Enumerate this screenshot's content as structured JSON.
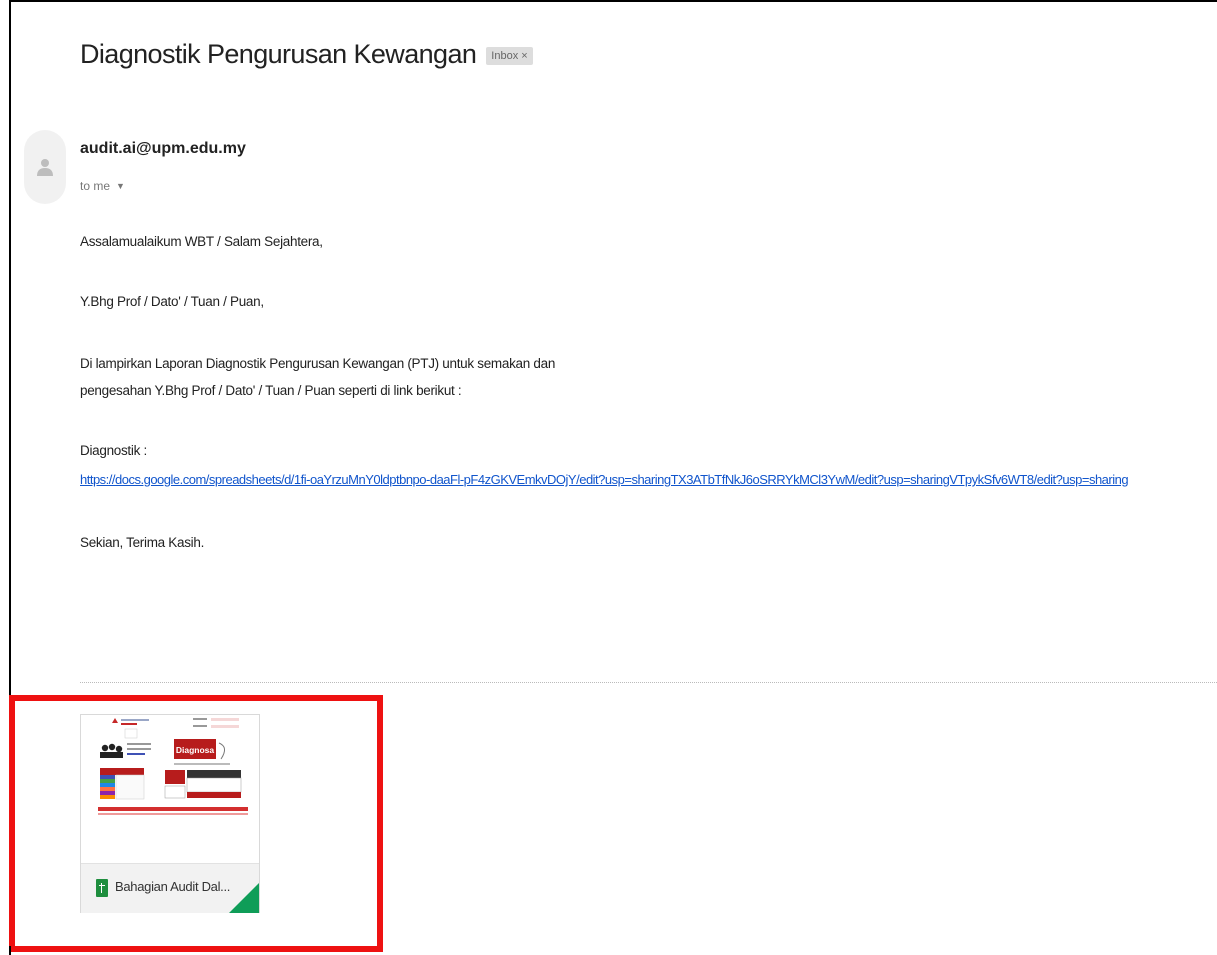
{
  "email": {
    "subject": "Diagnostik Pengurusan Kewangan",
    "label": "Inbox",
    "label_close": "×",
    "sender": "audit.ai@upm.edu.my",
    "recipient": "to me",
    "recipient_caret": "▼"
  },
  "body": {
    "greeting": "Assalamualaikum WBT / Salam Sejahtera,",
    "salutation": "Y.Bhg Prof / Dato' / Tuan / Puan,",
    "para1_line1": "Di lampirkan Laporan Diagnostik Pengurusan Kewangan (PTJ) untuk semakan dan",
    "para1_line2": "pengesahan Y.Bhg Prof / Dato' / Tuan / Puan seperti di link berikut :",
    "diagnostik_label": "Diagnostik :",
    "link": "https://docs.google.com/spreadsheets/d/1fi-oaYrzuMnY0ldptbnpo-daaFl-pF4zGKVEmkvDOjY/edit?usp=sharingTX3ATbTfNkJ6oSRRYkMCl3YwM/edit?usp=sharingVTpykSfv6WT8/edit?usp=sharing",
    "closing": "Sekian, Terima Kasih."
  },
  "attachment": {
    "name": "Bahagian Audit Dal...",
    "preview_button": "Diagnosa",
    "icon": "google-sheets-icon"
  },
  "colors": {
    "link": "#1155cc",
    "highlight": "#ee1111",
    "sheets_green": "#0f9d58",
    "preview_red": "#b71c1c"
  }
}
